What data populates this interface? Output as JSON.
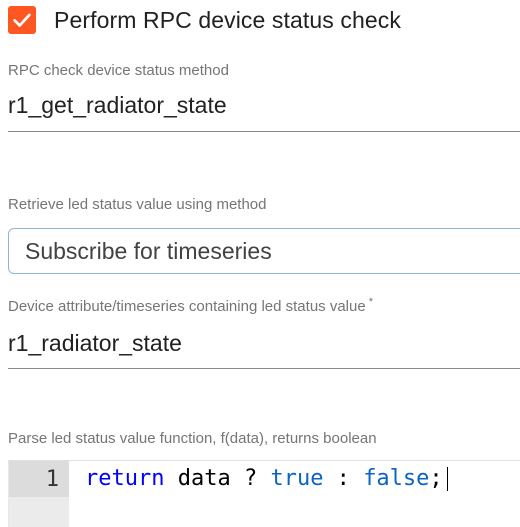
{
  "checkbox": {
    "label": "Perform RPC device status check",
    "checked": true,
    "color": "#ff5722"
  },
  "rpc_method": {
    "label": "RPC check device status method",
    "value": "r1_get_radiator_state"
  },
  "led_retrieval": {
    "label": "Retrieve led status value using method",
    "selected": "Subscribe for timeseries"
  },
  "led_attribute": {
    "label": "Device attribute/timeseries containing led status value",
    "required_mark": "*",
    "value": "r1_radiator_state"
  },
  "parse_function": {
    "label": "Parse led status value function, f(data), returns boolean",
    "line_number": "1",
    "code": {
      "kw_return": "return",
      "ident": " data ? ",
      "kw_true": "true",
      "sep": " : ",
      "kw_false": "false",
      "end": ";"
    }
  },
  "icons": {
    "check": "check-icon"
  }
}
